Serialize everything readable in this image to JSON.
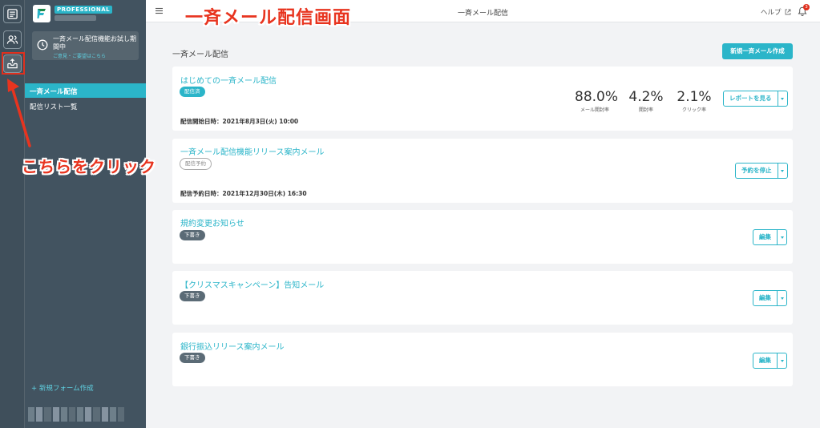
{
  "annotations": {
    "title_callout": "一斉メール配信画面",
    "click_callout": "こちらをクリック"
  },
  "rail": {
    "items": [
      {
        "icon": "forms-icon"
      },
      {
        "icon": "users-icon"
      },
      {
        "icon": "inbox-send-icon",
        "highlighted": true
      }
    ]
  },
  "sidebar": {
    "plan_badge": "PROFESSIONAL",
    "trial_text": "一斉メール配信機能お試し期間中",
    "trial_link": "ご意見・ご要望はこちら",
    "nav_items": [
      {
        "label": "一斉メール配信",
        "active": true
      },
      {
        "label": "配信リスト一覧",
        "active": false
      }
    ],
    "new_form_label": "+ 新規フォーム作成"
  },
  "header": {
    "title": "一斉メール配信",
    "help_label": "ヘルプ",
    "notification_count": "3"
  },
  "page": {
    "title": "一斉メール配信",
    "new_button": "新規一斉メール作成"
  },
  "campaigns": [
    {
      "title": "はじめての一斉メール配信",
      "status": "配信済",
      "date": "配信開始日時：2021年8月3日(火) 10:00",
      "stats": [
        {
          "value": "88.0%",
          "label": "メール開封率"
        },
        {
          "value": "4.2%",
          "label": "開封率"
        },
        {
          "value": "2.1%",
          "label": "クリック率"
        }
      ],
      "action": "レポートを見る"
    },
    {
      "title": "一斉メール配信機能リリース案内メール",
      "status": "配信予約",
      "date": "配信予約日時：2021年12月30日(木) 16:30",
      "action": "予約を停止"
    },
    {
      "title": "規約変更お知らせ",
      "status": "下書き",
      "action": "編集"
    },
    {
      "title": "【クリスマスキャンペーン】告知メール",
      "status": "下書き",
      "action": "編集"
    },
    {
      "title": "銀行振込リリース案内メール",
      "status": "下書き",
      "action": "編集"
    }
  ],
  "colors": {
    "accent": "#2bb5c9",
    "sidebar": "#425360",
    "rail": "#3f4f5b",
    "annotation_red": "#e8341f"
  }
}
